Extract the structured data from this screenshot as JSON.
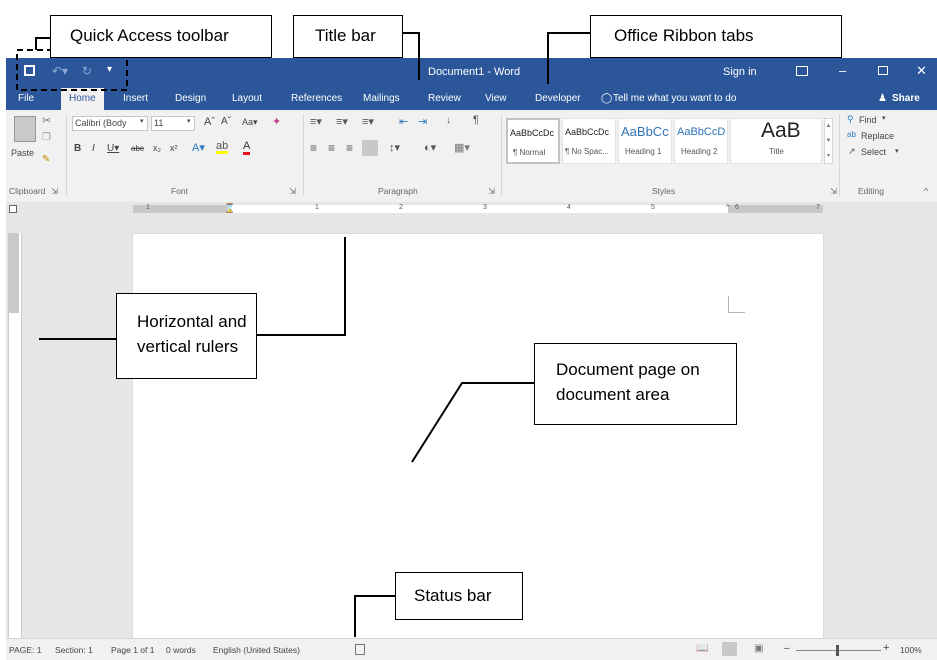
{
  "callouts": {
    "quick_access": "Quick Access toolbar",
    "title_bar": "Title bar",
    "ribbon_tabs": "Office Ribbon tabs",
    "rulers_line1": "Horizontal and",
    "rulers_line2": "vertical rulers",
    "document_line1": "Document page on",
    "document_line2": "document area",
    "status_bar": "Status bar"
  },
  "titlebar": {
    "doc_title": "Document1  -  Word",
    "sign_in": "Sign in",
    "save_icon": "save-icon",
    "undo_icon": "undo-icon",
    "redo_icon": "redo-icon",
    "customize_icon": "customize-qat-icon",
    "accent": "#2b579a"
  },
  "tabs": {
    "file": "File",
    "home": "Home",
    "insert": "Insert",
    "design": "Design",
    "layout": "Layout",
    "references": "References",
    "mailings": "Mailings",
    "review": "Review",
    "view": "View",
    "developer": "Developer",
    "tell_me": "Tell me what you want to do",
    "share": "Share"
  },
  "ribbon": {
    "paste": "Paste",
    "clipboard": "Clipboard",
    "font_name": "Calibri (Body",
    "font_size": "11",
    "font_group": "Font",
    "paragraph_group": "Paragraph",
    "styles_group": "Styles",
    "editing_group": "Editing",
    "styles": [
      {
        "preview": "AaBbCcDc",
        "name": "¶ Normal"
      },
      {
        "preview": "AaBbCcDc",
        "name": "¶ No Spac..."
      },
      {
        "preview": "AaBbCc",
        "name": "Heading 1"
      },
      {
        "preview": "AaBbCcD",
        "name": "Heading 2"
      },
      {
        "preview": "AaB",
        "name": "Title"
      }
    ],
    "find": "Find",
    "replace": "Replace",
    "select": "Select"
  },
  "ruler": {
    "numbers": [
      "1",
      "1",
      "2",
      "3",
      "4",
      "5",
      "6",
      "7"
    ]
  },
  "statusbar": {
    "page": "PAGE: 1",
    "section": "Section: 1",
    "page_of": "Page 1 of 1",
    "words": "0 words",
    "language": "English (United States)",
    "zoom": "100%"
  }
}
